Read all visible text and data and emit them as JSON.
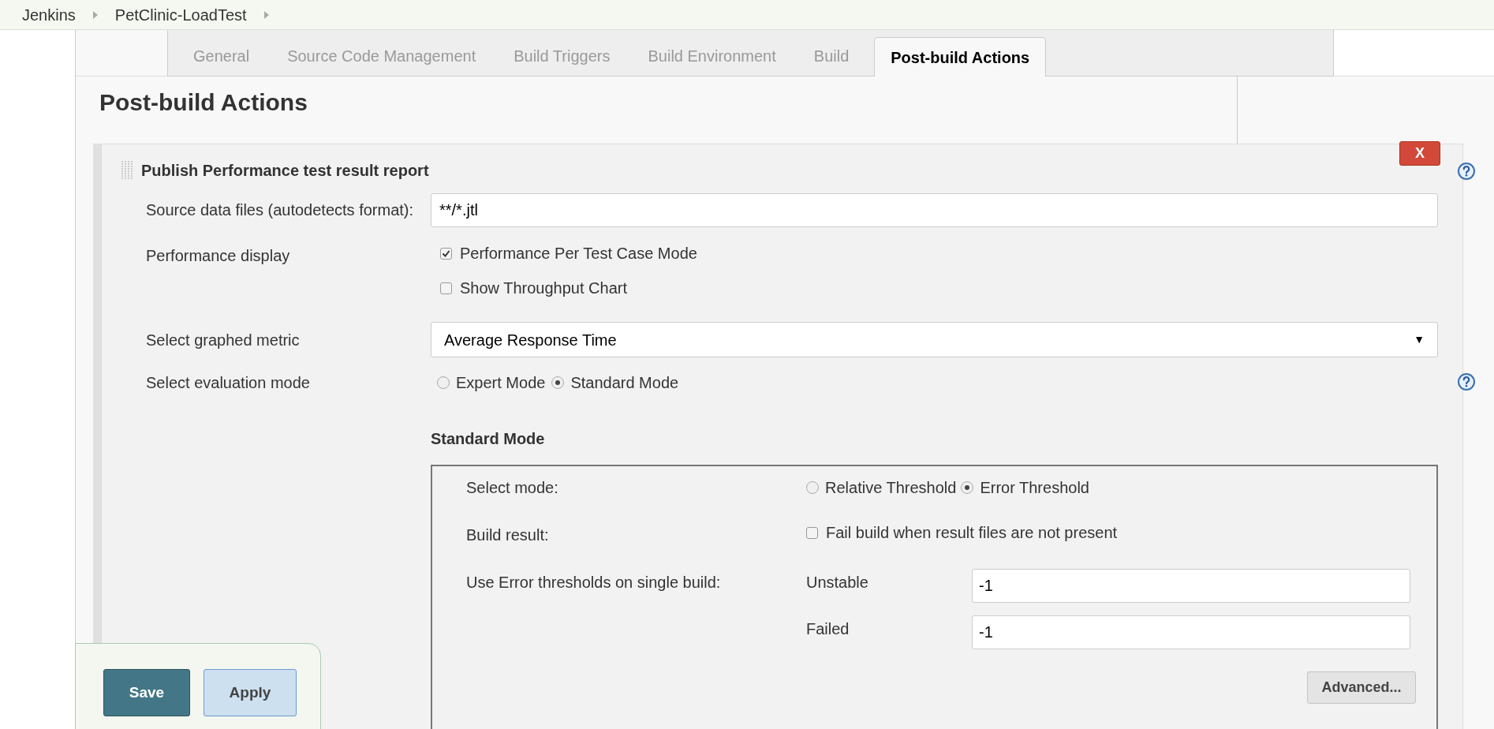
{
  "breadcrumbs": [
    {
      "label": "Jenkins"
    },
    {
      "label": "PetClinic-LoadTest"
    }
  ],
  "tabs": [
    {
      "label": "General",
      "selected": false
    },
    {
      "label": "Source Code Management",
      "selected": false
    },
    {
      "label": "Build Triggers",
      "selected": false
    },
    {
      "label": "Build Environment",
      "selected": false
    },
    {
      "label": "Build",
      "selected": false
    },
    {
      "label": "Post-build Actions",
      "selected": true
    }
  ],
  "page_title": "Post-build Actions",
  "section": {
    "title": "Publish Performance test result report",
    "delete_button": "X",
    "source_files": {
      "label": "Source data files (autodetects format):",
      "value": "**/*.jtl"
    },
    "performance_display": {
      "label": "Performance display",
      "options": [
        {
          "label": "Performance Per Test Case Mode",
          "checked": true
        },
        {
          "label": "Show Throughput Chart",
          "checked": false
        }
      ]
    },
    "graphed_metric": {
      "label": "Select graphed metric",
      "value": "Average Response Time",
      "arrow": "▼"
    },
    "evaluation_mode": {
      "label": "Select evaluation mode",
      "options": [
        {
          "label": "Expert Mode",
          "selected": false
        },
        {
          "label": "Standard Mode",
          "selected": true
        }
      ]
    },
    "standard_mode": {
      "heading": "Standard Mode",
      "select_mode": {
        "label": "Select mode:",
        "options": [
          {
            "label": "Relative Threshold",
            "selected": false
          },
          {
            "label": "Error Threshold",
            "selected": true
          }
        ]
      },
      "build_result": {
        "label": "Build result:",
        "options": [
          {
            "label": "Fail build when result files are not present",
            "checked": false
          }
        ]
      },
      "error_thresholds": {
        "label": "Use Error thresholds on single build:",
        "fields": [
          {
            "label": "Unstable",
            "value": "-1"
          },
          {
            "label": "Failed",
            "value": "-1"
          }
        ]
      },
      "advanced_button": "Advanced..."
    }
  },
  "buttons": {
    "save": "Save",
    "apply": "Apply"
  }
}
